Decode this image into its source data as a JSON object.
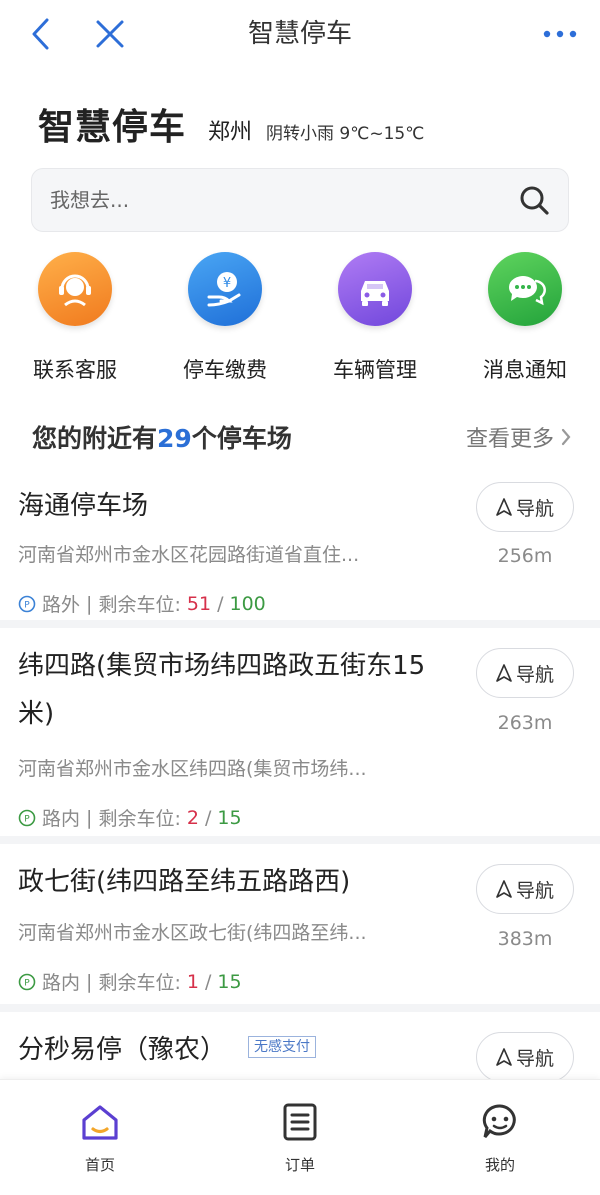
{
  "topbar": {
    "title": "智慧停车",
    "back_icon": "chevron-left-icon",
    "close_icon": "close-icon",
    "more_icon": "more-dots-icon"
  },
  "header": {
    "app_title": "智慧停车",
    "city": "郑州",
    "weather": "阴转小雨 9℃~15℃"
  },
  "search": {
    "placeholder": "我想去..."
  },
  "actions": [
    {
      "label": "联系客服",
      "icon": "customer-service-icon",
      "color": "#f38a2a"
    },
    {
      "label": "停车缴费",
      "icon": "payment-icon",
      "color": "#2f8ae6"
    },
    {
      "label": "车辆管理",
      "icon": "car-icon",
      "color": "#8a5be6"
    },
    {
      "label": "消息通知",
      "icon": "message-icon",
      "color": "#34b54a"
    }
  ],
  "section": {
    "prefix": "您的附近有",
    "count": "29",
    "suffix": "个停车场",
    "more": "查看更多"
  },
  "lots": [
    {
      "name": "海通停车场",
      "address": "河南省郑州市金水区花园路街道省直住...",
      "type": "路外",
      "remaining_label": "剩余车位:",
      "available": "51",
      "total": "100",
      "nav_label": "导航",
      "distance": "256m"
    },
    {
      "name": "纬四路(集贸市场纬四路政五街东15米)",
      "address": "河南省郑州市金水区纬四路(集贸市场纬...",
      "type": "路内",
      "remaining_label": "剩余车位:",
      "available": "2",
      "total": "15",
      "nav_label": "导航",
      "distance": "263m"
    },
    {
      "name": "政七街(纬四路至纬五路路西)",
      "address": "河南省郑州市金水区政七街(纬四路至纬...",
      "type": "路内",
      "remaining_label": "剩余车位:",
      "available": "1",
      "total": "15",
      "nav_label": "导航",
      "distance": "383m"
    },
    {
      "name": "分秒易停（豫农）",
      "badge": "无感支付",
      "nav_label": "导航"
    }
  ],
  "tabs": [
    {
      "label": "首页",
      "icon": "home-icon"
    },
    {
      "label": "订单",
      "icon": "order-icon"
    },
    {
      "label": "我的",
      "icon": "profile-icon"
    }
  ],
  "colors": {
    "accent_blue": "#2b6fd6",
    "available_red": "#d6304a",
    "total_green": "#3c9a43",
    "icon_blue": "#2d6ed8"
  }
}
